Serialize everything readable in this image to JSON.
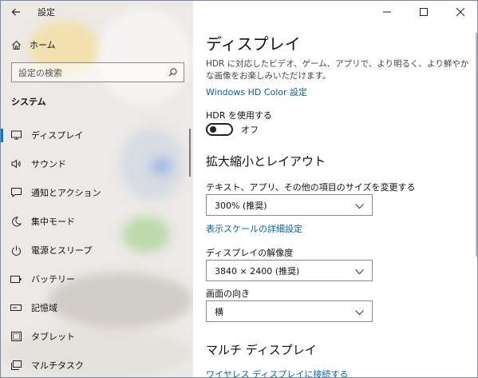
{
  "window": {
    "title": "設定",
    "controls": [
      "minimize-icon",
      "maximize-icon",
      "close-icon"
    ]
  },
  "sidebar": {
    "home_label": "ホーム",
    "search_placeholder": "設定の検索",
    "section_title": "システム",
    "items": [
      {
        "label": "ディスプレイ",
        "icon": "monitor-icon",
        "selected": true
      },
      {
        "label": "サウンド",
        "icon": "speaker-icon",
        "selected": false
      },
      {
        "label": "通知とアクション",
        "icon": "notification-icon",
        "selected": false
      },
      {
        "label": "集中モード",
        "icon": "moon-icon",
        "selected": false
      },
      {
        "label": "電源とスリープ",
        "icon": "power-icon",
        "selected": false
      },
      {
        "label": "バッテリー",
        "icon": "battery-icon",
        "selected": false
      },
      {
        "label": "記憶域",
        "icon": "storage-icon",
        "selected": false
      },
      {
        "label": "タブレット",
        "icon": "tablet-icon",
        "selected": false
      },
      {
        "label": "マルチタスク",
        "icon": "multitask-icon",
        "selected": false
      }
    ]
  },
  "main": {
    "page_title": "ディスプレイ",
    "hdr_description": "HDR に対応したビデオ、ゲーム、アプリで、より明るく、より鮮やかな画像をお楽しみいただけます。",
    "hdr_link": "Windows HD Color 設定",
    "hdr_toggle_label": "HDR を使用する",
    "hdr_toggle_state": "オフ",
    "scale_section_title": "拡大縮小とレイアウト",
    "scale_label": "テキスト、アプリ、その他の項目のサイズを変更する",
    "scale_value": "300% (推奨)",
    "scale_link": "表示スケールの詳細設定",
    "resolution_label": "ディスプレイの解像度",
    "resolution_value": "3840 × 2400 (推奨)",
    "orientation_label": "画面の向き",
    "orientation_value": "横",
    "multi_section_title": "マルチ ディスプレイ",
    "wireless_link": "ワイヤレス ディスプレイに接続する"
  },
  "colors": {
    "accent": "#0078d7",
    "link": "#0063b1",
    "sidebar_bg": "#ece9e6"
  }
}
